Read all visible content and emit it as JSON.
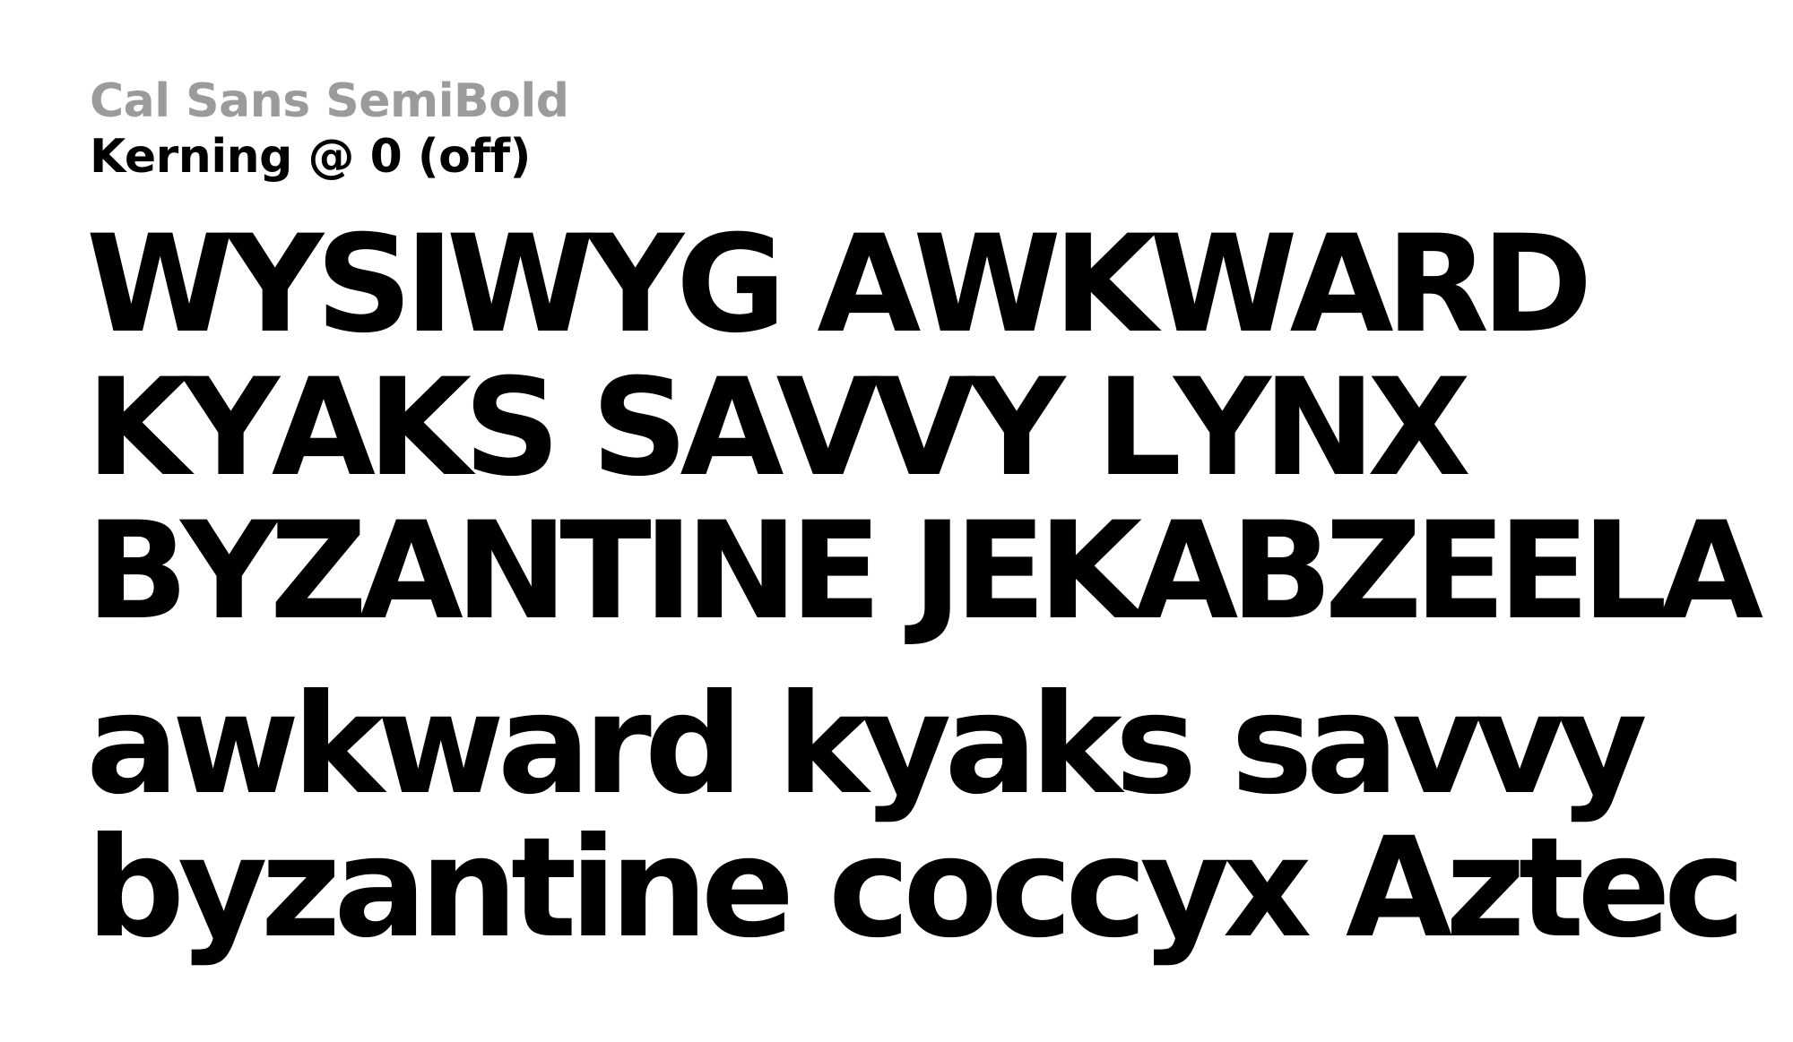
{
  "heading": {
    "font_name": "Cal Sans SemiBold",
    "kerning_label": "Kerning @ 0 (off)"
  },
  "samples": {
    "uppercase": [
      "WYSIWYG AWKWARD",
      "KYAKS SAVVY LYNX",
      "BYZANTINE JEKABZEELA"
    ],
    "lowercase": [
      "awkward kyaks savvy",
      "byzantine coccyx Aztec"
    ]
  },
  "colors": {
    "font_name": "#9b9b9b",
    "text": "#000000",
    "background": "#ffffff"
  }
}
